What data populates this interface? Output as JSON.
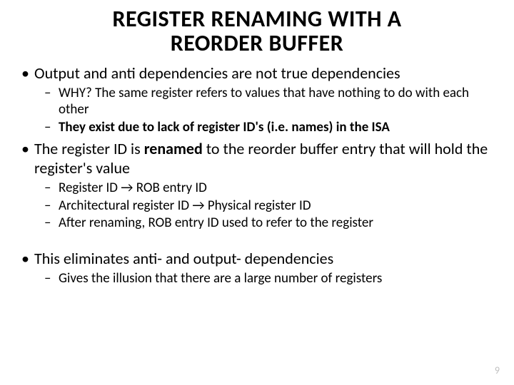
{
  "title_line1": "REGISTER RENAMING WITH A",
  "title_line2": "REORDER BUFFER",
  "b1": {
    "text": "Output and anti dependencies are not true dependencies",
    "sub": [
      {
        "html": "WHY? The same register refers to values that have nothing to do with each other"
      },
      {
        "html": "<span class='b'>They exist due to lack of register ID's (i.e. names) in the ISA</span>"
      }
    ]
  },
  "b2": {
    "html": "The register ID is <span class='b'>renamed</span> to the reorder buffer entry that will hold the register's value",
    "sub": [
      {
        "html": "Register ID &rarr; ROB entry ID"
      },
      {
        "html": "Architectural register ID &rarr; Physical register ID"
      },
      {
        "html": "After renaming, ROB entry ID used to refer to the register"
      }
    ]
  },
  "b3": {
    "text": "This eliminates anti- and output- dependencies",
    "sub": [
      {
        "html": "Gives the illusion that there are a large number of registers"
      }
    ]
  },
  "page_number": "9"
}
